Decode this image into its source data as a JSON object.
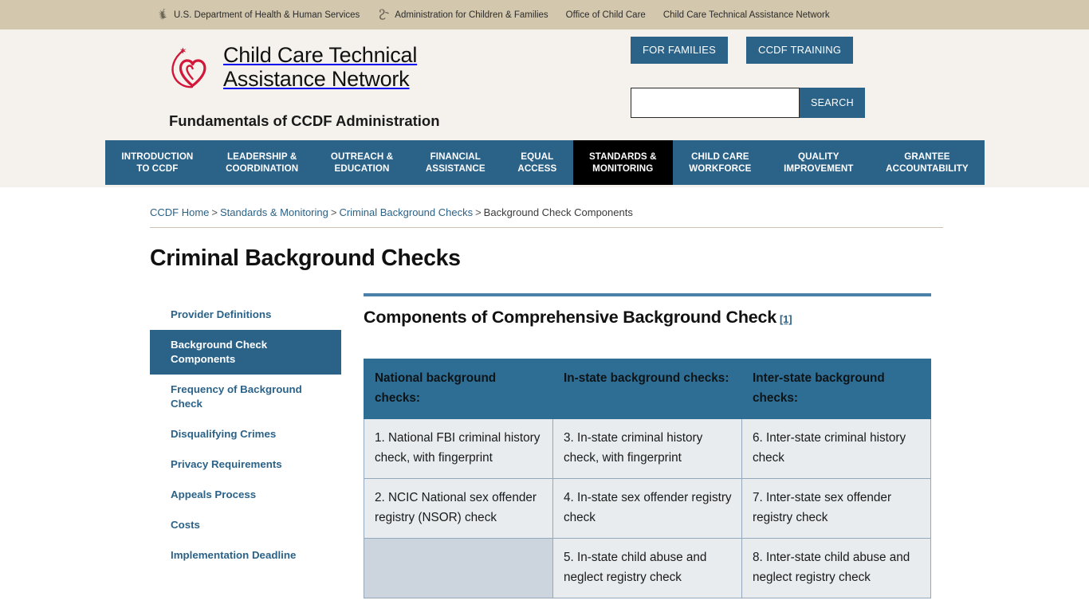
{
  "gov_bar": {
    "items": [
      {
        "label": "U.S. Department of Health & Human Services",
        "icon": "hhs-logo-icon"
      },
      {
        "label": "Administration for Children & Families",
        "icon": "acf-logo-icon"
      },
      {
        "label": "Office of Child Care",
        "icon": ""
      },
      {
        "label": "Child Care Technical Assistance Network",
        "icon": ""
      }
    ]
  },
  "masthead": {
    "brand_line1": "Child Care Technical",
    "brand_line2": "Assistance Network",
    "tagline": "Fundamentals of CCDF Administration",
    "for_families_label": "FOR FAMILIES",
    "ccdf_training_label": "CCDF TRAINING",
    "search_value": "",
    "search_placeholder": "",
    "search_button_label": "SEARCH"
  },
  "nav": {
    "items": [
      {
        "line1": "INTRODUCTION",
        "line2": "TO CCDF",
        "active": false
      },
      {
        "line1": "LEADERSHIP &",
        "line2": "COORDINATION",
        "active": false
      },
      {
        "line1": "OUTREACH &",
        "line2": "EDUCATION",
        "active": false
      },
      {
        "line1": "FINANCIAL",
        "line2": "ASSISTANCE",
        "active": false
      },
      {
        "line1": "EQUAL",
        "line2": "ACCESS",
        "active": false
      },
      {
        "line1": "STANDARDS &",
        "line2": "MONITORING",
        "active": true
      },
      {
        "line1": "CHILD CARE",
        "line2": "WORKFORCE",
        "active": false
      },
      {
        "line1": "QUALITY",
        "line2": "IMPROVEMENT",
        "active": false
      },
      {
        "line1": "GRANTEE",
        "line2": "ACCOUNTABILITY",
        "active": false
      }
    ]
  },
  "breadcrumb": {
    "items": [
      {
        "label": "CCDF Home",
        "link": true
      },
      {
        "label": "Standards & Monitoring",
        "link": true
      },
      {
        "label": "Criminal Background Checks",
        "link": true
      },
      {
        "label": "Background Check Components",
        "link": false
      }
    ],
    "separator": ">"
  },
  "page": {
    "title": "Criminal Background Checks"
  },
  "sidebar": {
    "items": [
      {
        "label": "Provider Definitions",
        "active": false
      },
      {
        "label": "Background Check Components",
        "active": true
      },
      {
        "label": "Frequency of Background Check",
        "active": false
      },
      {
        "label": "Disqualifying Crimes",
        "active": false
      },
      {
        "label": "Privacy Requirements",
        "active": false
      },
      {
        "label": "Appeals Process",
        "active": false
      },
      {
        "label": "Costs",
        "active": false
      },
      {
        "label": "Implementation Deadline",
        "active": false
      }
    ]
  },
  "main": {
    "section_title": "Components of Comprehensive Background Check",
    "footnote_ref": "[1]",
    "table": {
      "headers": [
        "National background checks:",
        "In-state background checks:",
        "Inter-state background checks:"
      ],
      "rows": [
        [
          "1. National FBI criminal history check, with fingerprint",
          "3. In-state criminal history check, with fingerprint",
          "6. Inter-state criminal history check"
        ],
        [
          "2. NCIC National sex offender registry (NSOR) check",
          "4. In-state sex offender registry check",
          "7. Inter-state sex offender registry check"
        ],
        [
          "",
          "5. In-state child abuse and neglect registry check",
          "8. Inter-state child abuse and neglect registry check"
        ]
      ]
    }
  },
  "colors": {
    "gov_bar_bg": "#d3c7ad",
    "masthead_bg": "#f5f2ed",
    "brand_accent": "#d1173a",
    "nav_bg": "#2b6288",
    "nav_active_bg": "#000000",
    "link": "#2b6288",
    "table_header_bg": "#2e6d94",
    "table_cell_bg": "#e8ecef",
    "table_empty_cell_bg": "#ccd5de",
    "rule": "#4a81a8"
  }
}
